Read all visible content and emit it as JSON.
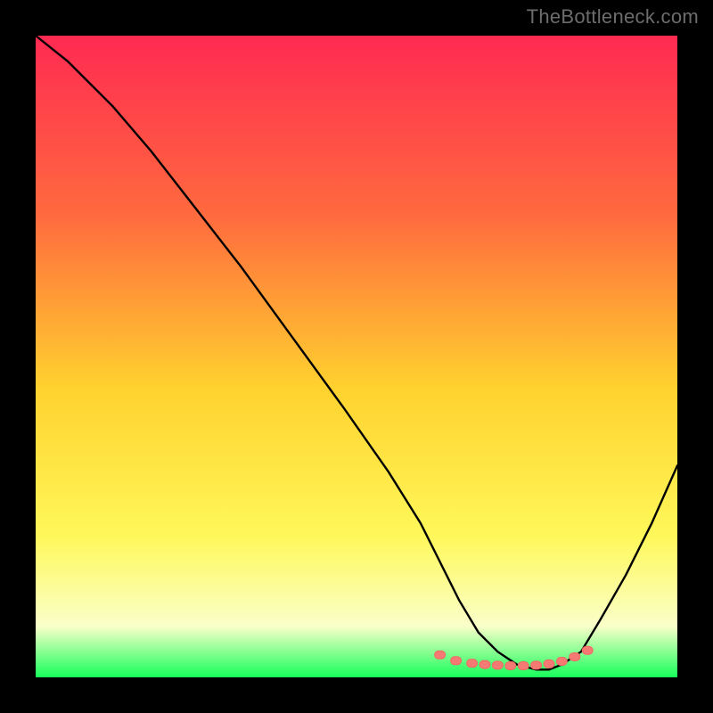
{
  "watermark": "TheBottleneck.com",
  "colors": {
    "frame": "#000000",
    "curve": "#000000",
    "marker_fill": "#f47a73",
    "marker_stroke": "#f06a64",
    "grad_top": "#ff2a52",
    "grad_mid_upper": "#ff6a3e",
    "grad_mid": "#ffd22e",
    "grad_mid_lower": "#fff85a",
    "grad_low": "#faffc9",
    "grad_bottom": "#17ff5b"
  },
  "chart_data": {
    "type": "line",
    "title": "",
    "xlabel": "",
    "ylabel": "",
    "xlim": [
      0,
      100
    ],
    "ylim": [
      0,
      100
    ],
    "series": [
      {
        "name": "bottleneck-curve",
        "x": [
          0,
          5,
          8,
          12,
          18,
          25,
          32,
          40,
          48,
          55,
          60,
          63,
          66,
          69,
          72,
          75,
          78,
          80,
          82,
          85,
          88,
          92,
          96,
          100
        ],
        "y": [
          100,
          96,
          93,
          89,
          82,
          73,
          64,
          53,
          42,
          32,
          24,
          18,
          12,
          7,
          4,
          2,
          1.2,
          1.2,
          2,
          4,
          9,
          16,
          24,
          33
        ]
      }
    ],
    "markers": {
      "name": "highlight-band",
      "x": [
        63,
        65.5,
        68,
        70,
        72,
        74,
        76,
        78,
        80,
        82,
        84,
        86
      ],
      "y": [
        3.5,
        2.6,
        2.2,
        2.0,
        1.9,
        1.8,
        1.8,
        1.9,
        2.1,
        2.5,
        3.2,
        4.2
      ]
    }
  }
}
